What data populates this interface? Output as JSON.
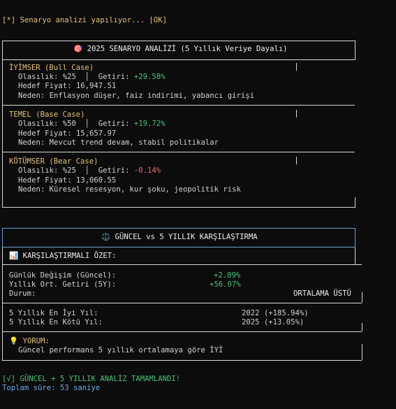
{
  "status_line": "[*] Senaryo analizi yapılıyor... [OK]",
  "scenario_header": "🎯 2025 SENARYO ANALİZİ (5 Yıllık Veriye Dayalı)",
  "scenarios": [
    {
      "name": "İYİMSER (Bull Case)",
      "prob_label": "Olasılık: %25  │  Getiri: ",
      "return": "+29.58%",
      "target": "Hedef Fiyat: 16,947.51",
      "reason": "Neden: Enflasyon düşer, faiz indirimi, yabancı girişi"
    },
    {
      "name": "TEMEL (Base Case)",
      "prob_label": "Olasılık: %50  │  Getiri: ",
      "return": "+19.72%",
      "target": "Hedef Fiyat: 15,657.97",
      "reason": "Neden: Mevcut trend devam, stabil politikalar"
    },
    {
      "name": "KÖTÜMSER (Bear Case)",
      "prob_label": "Olasılık: %25  │  Getiri: ",
      "return": "-0.14%",
      "target": "Hedef Fiyat: 13,060.55",
      "reason": "Neden: Küresel resesyon, kur şoku, jeopolitik risk"
    }
  ],
  "compare_header": "⚖️ GÜNCEL vs 5 YILLIK KARŞILAŞTIRMA",
  "summary_title": "📊 KARŞILAŞTIRMALI ÖZET:",
  "daily_change": {
    "label": "Günlük Değişim (Güncel):",
    "value": "+2.09%"
  },
  "annual_return": {
    "label": "Yıllık Ort. Getiri (5Y):",
    "value": "+56.07%"
  },
  "status": {
    "label": "Durum:",
    "value": "ORTALAMA ÜSTÜ"
  },
  "best_year": {
    "label": "5 Yıllık En İyi Yıl:",
    "value": "2022 (+185.94%)"
  },
  "worst_year": {
    "label": "5 Yıllık En Kötü Yıl:",
    "value": "2025 (+13.05%)"
  },
  "comment_title": "💡 YORUM:",
  "comment": "Güncel performans 5 yıllık ortalamaya göre İYİ",
  "done_line": "[√] GÜNCEL + 5 YILLIK ANALİZ TAMAMLANDI!",
  "total_time": "Toplam süre: 53 saniye",
  "colors": {
    "accent": "#e5c07b",
    "positive": "#4ec27a",
    "negative": "#e06c75",
    "info": "#5ec4dc",
    "frame": "#6fa0d8"
  }
}
